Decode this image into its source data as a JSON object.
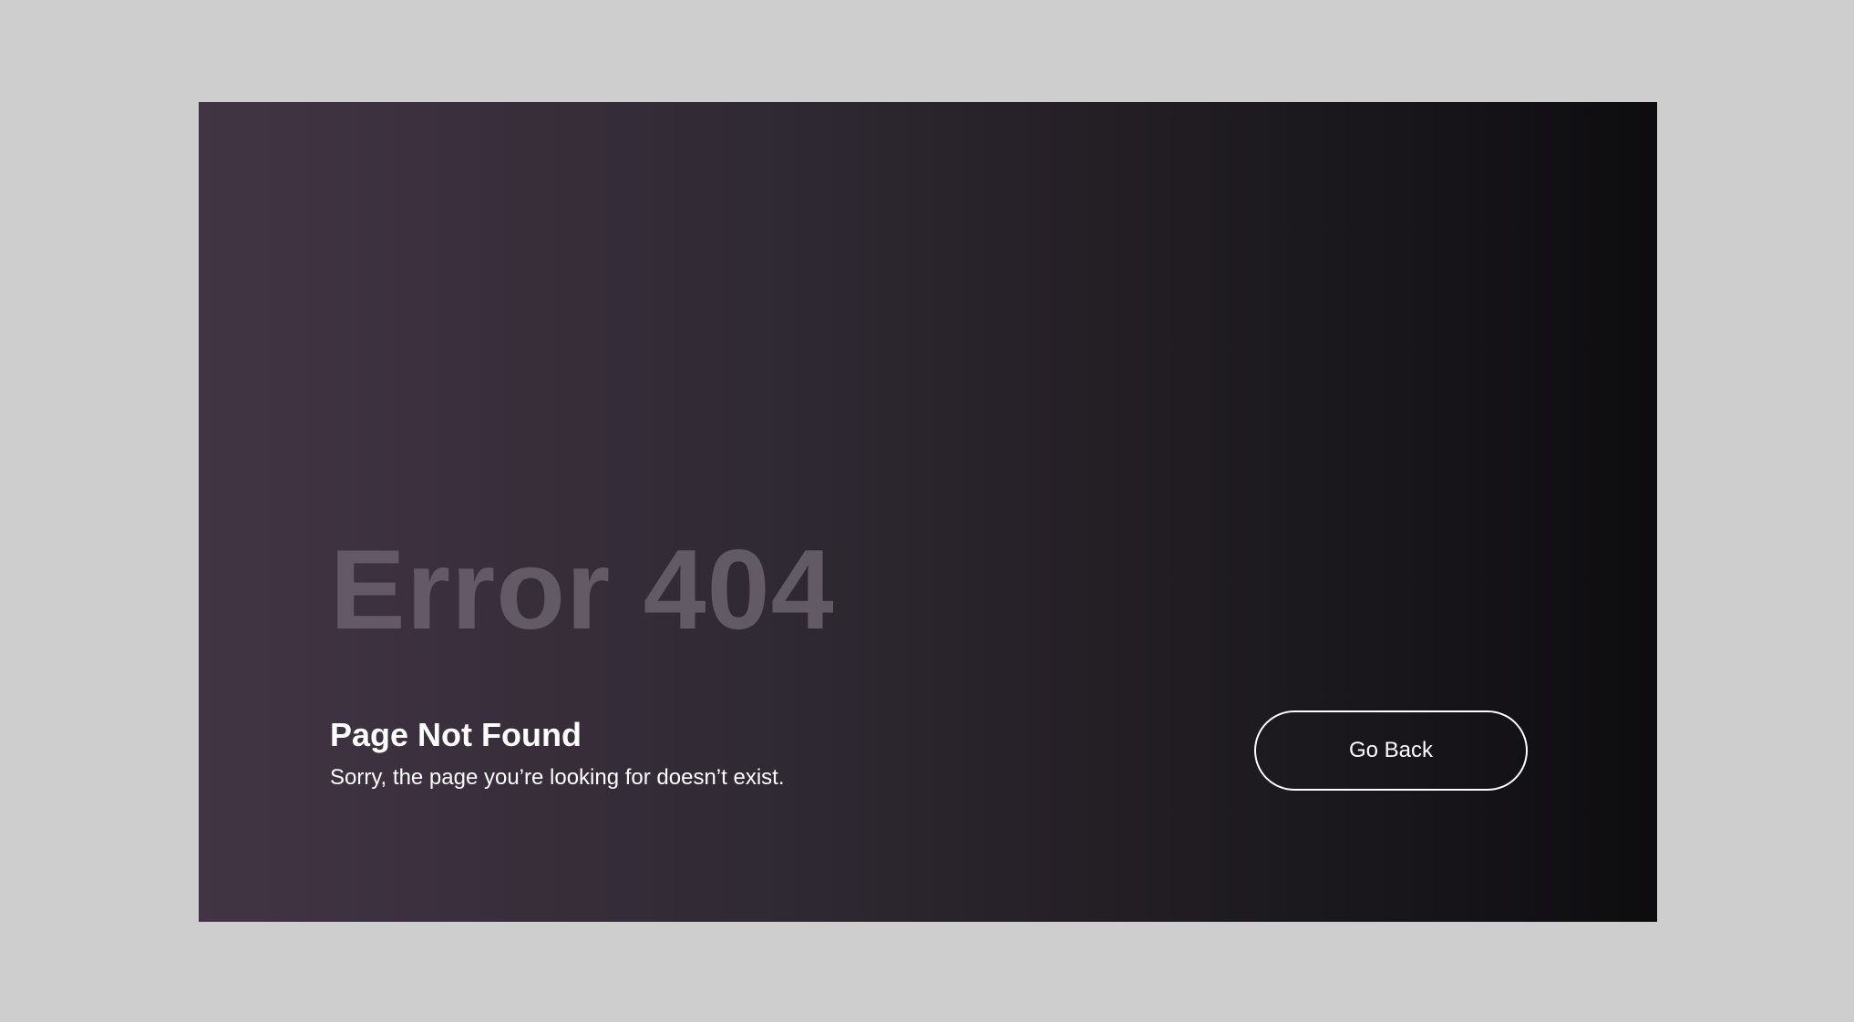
{
  "error_page": {
    "code_text": "Error 404",
    "title": "Page Not Found",
    "message": "Sorry, the page you’re looking for doesn’t exist.",
    "back_button_label": "Go Back"
  },
  "colors": {
    "page_background": "#cecece",
    "card_gradient_start": "#413543",
    "card_gradient_end": "#0d0c0e",
    "error_code_text": "#625a64",
    "primary_text": "#ffffff",
    "button_border": "#ffffff"
  }
}
